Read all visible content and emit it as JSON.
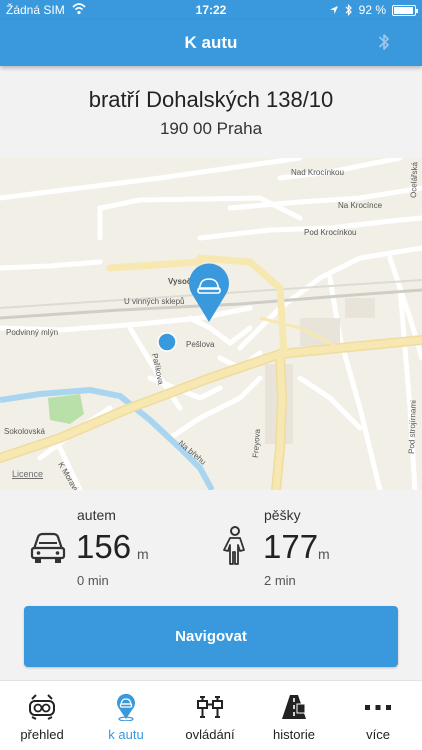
{
  "status_bar": {
    "carrier": "Žádná SIM",
    "time": "17:22",
    "battery": "92 %"
  },
  "header": {
    "title": "K autu",
    "icon": "bluetooth-icon"
  },
  "address": {
    "street": "bratří Dohalských 138/10",
    "city": "190 00 Praha"
  },
  "map": {
    "street_labels": [
      "Nad Krocínkou",
      "Na Krocínce",
      "Pod Krocínkou",
      "Vysočanská",
      "U vinných sklepů",
      "Podvinný mlýn",
      "Pešlova",
      "Paříkova",
      "Freyova",
      "Na břehu",
      "Pod strojírnami",
      "Ocelářská",
      "Sokolovská",
      "K Moravině"
    ],
    "licence_link": "Licence",
    "car_marker_icon": "car-pin-icon",
    "user_marker_icon": "user-location-icon"
  },
  "distances": {
    "car": {
      "mode": "autem",
      "value": "156",
      "unit": "m",
      "time": "0 min",
      "icon": "car-icon"
    },
    "walk": {
      "mode": "pěšky",
      "value": "177",
      "unit": "m",
      "time": "2 min",
      "icon": "walking-person-icon"
    }
  },
  "navigate_button": {
    "label": "Navigovat"
  },
  "tabs": [
    {
      "label": "přehled",
      "icon": "dashboard-icon",
      "active": false
    },
    {
      "label": "k autu",
      "icon": "location-pin-icon",
      "active": true
    },
    {
      "label": "ovládání",
      "icon": "controls-icon",
      "active": false
    },
    {
      "label": "historie",
      "icon": "history-road-icon",
      "active": false
    },
    {
      "label": "více",
      "icon": "more-icon",
      "active": false
    }
  ],
  "colors": {
    "accent": "#3a99dd",
    "map_background": "#f2efe6",
    "road_major": "#f7e7b0",
    "water": "#a9d5f0",
    "park": "#b9e0a9"
  }
}
